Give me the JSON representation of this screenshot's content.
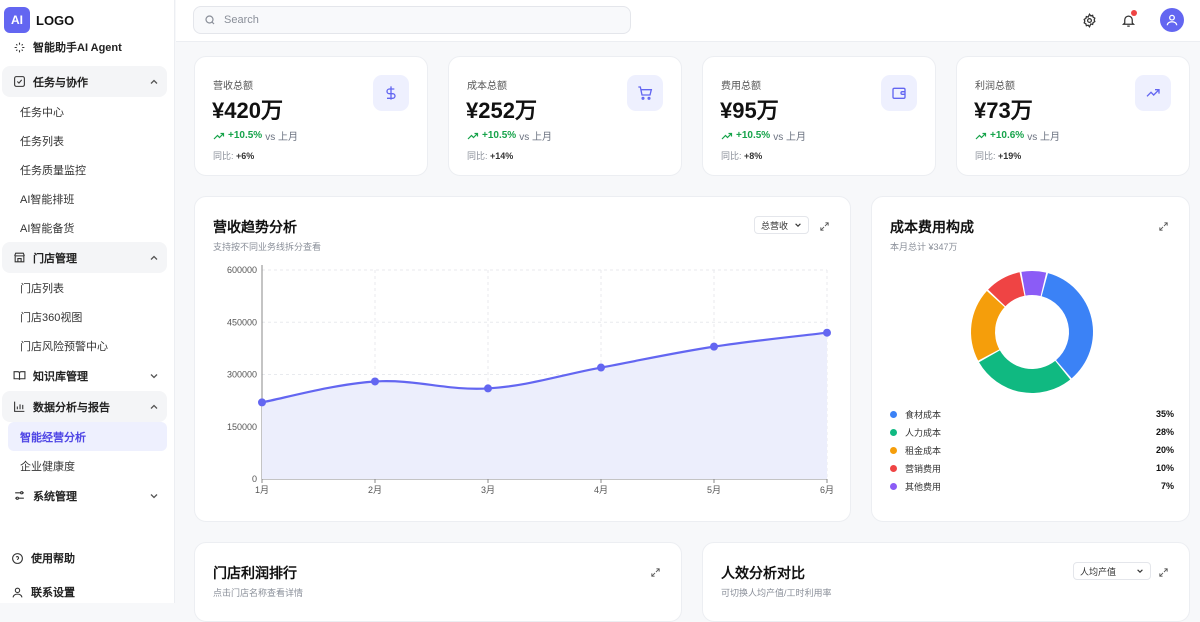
{
  "brand": {
    "mark": "AI",
    "name": "LOGO"
  },
  "search": {
    "placeholder": "Search"
  },
  "colors": {
    "accent": "#6366f1",
    "positive": "#16a34a",
    "alert": "#ef4444"
  },
  "sidebar": {
    "top_item": "智能助手AI Agent",
    "groups": [
      {
        "label": "任务与协作",
        "expanded": true,
        "items": [
          "任务中心",
          "任务列表",
          "任务质量监控",
          "AI智能排班",
          "AI智能备货"
        ]
      },
      {
        "label": "门店管理",
        "expanded": true,
        "items": [
          "门店列表",
          "门店360视图",
          "门店风险预警中心"
        ]
      },
      {
        "label": "知识库管理",
        "expanded": false,
        "items": []
      },
      {
        "label": "数据分析与报告",
        "expanded": true,
        "items": [
          "智能经营分析",
          "企业健康度"
        ]
      },
      {
        "label": "系统管理",
        "expanded": false,
        "items": []
      }
    ],
    "active_item": "智能经营分析",
    "footer": [
      {
        "label": "使用帮助",
        "icon": "help-icon"
      },
      {
        "label": "联系设置",
        "icon": "user-icon"
      }
    ]
  },
  "kpis": [
    {
      "label": "营收总额",
      "value": "¥420万",
      "change": "+10.5%",
      "vs": "vs 上月",
      "yoy_label": "同比:",
      "yoy": "+6%",
      "icon": "dollar-icon"
    },
    {
      "label": "成本总额",
      "value": "¥252万",
      "change": "+10.5%",
      "vs": "vs 上月",
      "yoy_label": "同比:",
      "yoy": "+14%",
      "icon": "cart-icon"
    },
    {
      "label": "费用总额",
      "value": "¥95万",
      "change": "+10.5%",
      "vs": "vs 上月",
      "yoy_label": "同比:",
      "yoy": "+8%",
      "icon": "wallet-icon"
    },
    {
      "label": "利润总额",
      "value": "¥73万",
      "change": "+10.6%",
      "vs": "vs 上月",
      "yoy_label": "同比:",
      "yoy": "+19%",
      "icon": "trend-up-icon"
    }
  ],
  "revenue_card": {
    "title": "营收趋势分析",
    "subtitle": "支持按不同业务线拆分查看",
    "select": "总营收"
  },
  "cost_card": {
    "title": "成本费用构成",
    "subtitle": "本月总计 ¥347万"
  },
  "store_card": {
    "title": "门店利润排行",
    "subtitle": "点击门店名称查看详情"
  },
  "efficiency_card": {
    "title": "人效分析对比",
    "subtitle": "可切换人均产值/工时利用率",
    "select": "人均产值"
  },
  "chart_data": [
    {
      "type": "area",
      "categories": [
        "1月",
        "2月",
        "3月",
        "4月",
        "5月",
        "6月"
      ],
      "series": [
        {
          "values": [
            220000,
            280000,
            260000,
            320000,
            380000,
            420000
          ],
          "color": "#6366f1"
        }
      ],
      "yticks": [
        0,
        150000,
        300000,
        450000,
        600000
      ],
      "ylim": [
        0,
        600000
      ],
      "grid": true
    },
    {
      "type": "pie",
      "donut": true,
      "labels": [
        "食材成本",
        "人力成本",
        "租金成本",
        "营销费用",
        "其他费用"
      ],
      "values": [
        35,
        28,
        20,
        10,
        7
      ],
      "display": [
        "35%",
        "28%",
        "20%",
        "10%",
        "7%"
      ],
      "colors": [
        "#3b82f6",
        "#10b981",
        "#f59e0b",
        "#ef4444",
        "#8b5cf6"
      ],
      "legend": "bottom"
    }
  ]
}
